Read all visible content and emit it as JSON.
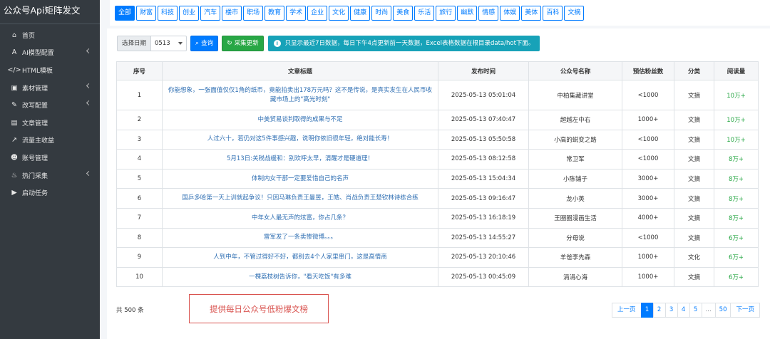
{
  "sidebar": {
    "brand": "公众号Api矩阵发文",
    "items": [
      {
        "label": "首页",
        "icon": "home-icon",
        "glyph": "⌂",
        "chevron": false
      },
      {
        "label": "AI模型配置",
        "icon": "text-a-icon",
        "glyph": "A",
        "chevron": true
      },
      {
        "label": "HTML模板",
        "icon": "code-icon",
        "glyph": "</>",
        "chevron": false
      },
      {
        "label": "素材管理",
        "icon": "image-icon",
        "glyph": "▣",
        "chevron": true
      },
      {
        "label": "改写配置",
        "icon": "edit-icon",
        "glyph": "✎",
        "chevron": true
      },
      {
        "label": "文章管理",
        "icon": "document-icon",
        "glyph": "▤",
        "chevron": false
      },
      {
        "label": "流量主收益",
        "icon": "chart-line-icon",
        "glyph": "↗",
        "chevron": false
      },
      {
        "label": "账号管理",
        "icon": "users-icon",
        "glyph": "☻",
        "chevron": false
      },
      {
        "label": "热门采集",
        "icon": "fire-icon",
        "glyph": "♨",
        "chevron": true
      },
      {
        "label": "启动任务",
        "icon": "play-circle-icon",
        "glyph": "▶",
        "chevron": false
      }
    ]
  },
  "categories": [
    "全部",
    "财富",
    "科技",
    "创业",
    "汽车",
    "楼市",
    "职场",
    "教育",
    "学术",
    "企业",
    "文化",
    "健康",
    "时尚",
    "美食",
    "乐活",
    "旅行",
    "幽默",
    "情感",
    "体娱",
    "美体",
    "百科",
    "文摘"
  ],
  "active_category": "全部",
  "toolbar": {
    "date_label": "选择日期",
    "date_value": "0513",
    "query_label": "查询",
    "collect_label": "采集更新",
    "notice": "只显示最近7日数据，每日下午4点更新前一天数据，Excel表格数据在根目录data/hot下面。"
  },
  "table": {
    "headers": [
      "序号",
      "文章标题",
      "发布时间",
      "公众号名称",
      "预估粉丝数",
      "分类",
      "阅读量"
    ],
    "rows": [
      {
        "no": "1",
        "title": "你能想象，一张面值仅仅1角的纸币，竟能拍卖出178万元吗？这不是传说，是真实发生在人民币收藏市场上的\"高光时刻\"",
        "time": "2025-05-13 05:01:04",
        "account": "中柏集藏讲堂",
        "fans": "<1000",
        "category": "文摘",
        "reads": "10万+"
      },
      {
        "no": "2",
        "title": "中美贸易谈判取得的成果与不足",
        "time": "2025-05-13 07:40:47",
        "account": "超越左中右",
        "fans": "1000+",
        "category": "文摘",
        "reads": "10万+"
      },
      {
        "no": "3",
        "title": "人过六十，若仍对这5件事感兴趣，说明你依旧很年轻，绝对能长寿！",
        "time": "2025-05-13 05:50:58",
        "account": "小高的蜕变之路",
        "fans": "<1000",
        "category": "文摘",
        "reads": "10万+"
      },
      {
        "no": "4",
        "title": "5月13日:关税战缓和：别欢呼太早，清醒才是硬道理！",
        "time": "2025-05-13 08:12:58",
        "account": "常卫军",
        "fans": "<1000",
        "category": "文摘",
        "reads": "8万+"
      },
      {
        "no": "5",
        "title": "体制内女干部一定要爱惜自己的名声",
        "time": "2025-05-13 15:04:34",
        "account": "小陈铺子",
        "fans": "3000+",
        "category": "文摘",
        "reads": "8万+"
      },
      {
        "no": "6",
        "title": "国乒多哈第一天上训就起争议！只因马琳负责王曼昱，王皓、肖战负责王楚钦林诗栋合练",
        "time": "2025-05-13 09:16:47",
        "account": "龙小英",
        "fans": "3000+",
        "category": "文摘",
        "reads": "8万+"
      },
      {
        "no": "7",
        "title": "中年女人最无声的炫富，你占几条？",
        "time": "2025-05-13 16:18:19",
        "account": "王圈圈漫画生活",
        "fans": "4000+",
        "category": "文摘",
        "reads": "8万+"
      },
      {
        "no": "8",
        "title": "雷军发了一条卖惨微博。。。",
        "time": "2025-05-13 14:55:27",
        "account": "分母说",
        "fans": "<1000",
        "category": "文摘",
        "reads": "6万+"
      },
      {
        "no": "9",
        "title": "人到中年，不管过得好不好，都别去4个人家里串门，这是高情商",
        "time": "2025-05-13 20:10:46",
        "account": "羊爸李先森",
        "fans": "1000+",
        "category": "文化",
        "reads": "6万+"
      },
      {
        "no": "10",
        "title": "一棵荔枝树告诉你，\"看天吃饭\"有多难",
        "time": "2025-05-13 00:45:09",
        "account": "涓涓心海",
        "fans": "1000+",
        "category": "文摘",
        "reads": "6万+"
      }
    ]
  },
  "footer": {
    "total": "共 500 条",
    "callout": "提供每日公众号低粉爆文榜"
  },
  "pagination": {
    "prev": "上一页",
    "pages": [
      "1",
      "2",
      "3",
      "4",
      "5",
      "...",
      "50"
    ],
    "active": "1",
    "next": "下一页"
  },
  "colors": {
    "sidebar_bg": "#343a40",
    "primary": "#007bff",
    "success": "#28a745",
    "info": "#17a2b8",
    "callout_red": "#d9534f"
  }
}
